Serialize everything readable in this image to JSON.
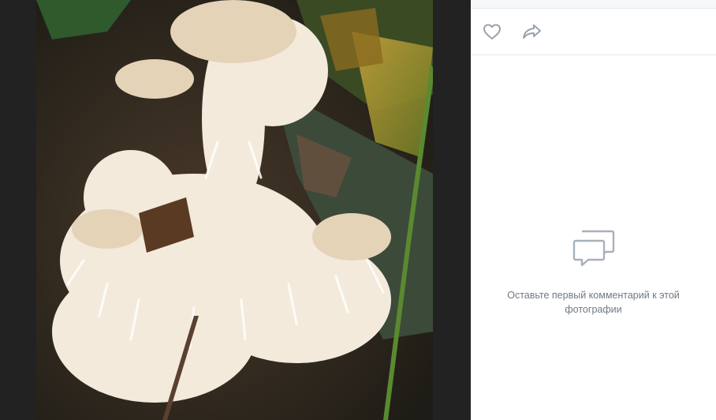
{
  "photo": {
    "subject": "coral-fungus-photo"
  },
  "actions": {
    "like_icon": "heart-icon",
    "share_icon": "share-arrow-icon"
  },
  "comments": {
    "empty_icon": "speech-bubbles-icon",
    "empty_text": "Оставьте первый комментарий к этой фотографии"
  },
  "colors": {
    "viewer_bg": "#222222",
    "panel_bg": "#ffffff",
    "icon_color": "#99a2ad",
    "text_muted": "#6f7985"
  }
}
